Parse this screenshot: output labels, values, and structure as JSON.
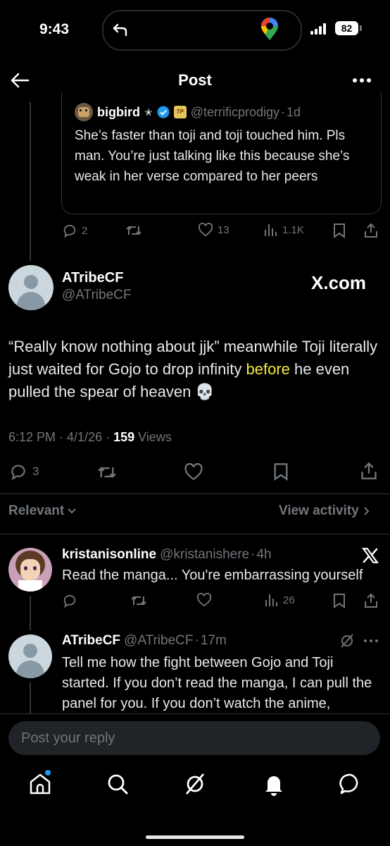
{
  "status": {
    "time": "9:43",
    "battery": "82"
  },
  "header": {
    "title": "Post"
  },
  "quoted": {
    "name": "bigbird",
    "handle": "@terrificprodigy",
    "sep": "·",
    "age": "1d",
    "text": "She’s faster than toji and toji touched him. Pls man. You’re just talking like this because she’s weak in her verse compared to her peers",
    "replies": "2",
    "likes": "13",
    "views": "1.1K"
  },
  "main": {
    "name": "ATribeCF",
    "handle": "@ATribeCF",
    "brand": "X.com",
    "text_before": "“Really know nothing about jjk” meanwhile Toji literally just waited for Gojo to drop infinity ",
    "highlight": "before",
    "text_after": " he even pulled the spear of heaven 💀",
    "time": "6:12 PM · 4/1/26 · ",
    "views_count": "159",
    "views_label": " Views",
    "replies": "3"
  },
  "sort": {
    "label": "Relevant",
    "view_activity": "View activity"
  },
  "replies": [
    {
      "name": "kristanisonline",
      "handle": "@kristanishere",
      "sep": "·",
      "age": "4h",
      "text": "Read the manga... You're embarrassing yourself",
      "views": "26"
    },
    {
      "name": "ATribeCF",
      "handle": "@ATribeCF",
      "sep": "·",
      "age": "17m",
      "text": "Tell me how the fight between Gojo and Toji started. If you don’t read the manga, I can pull the panel for you. If you don’t watch the anime,"
    }
  ],
  "reply_box": {
    "placeholder": "Post your reply"
  },
  "colors": {
    "accent": "#1d9bf0",
    "highlight": "#f5e93a"
  }
}
